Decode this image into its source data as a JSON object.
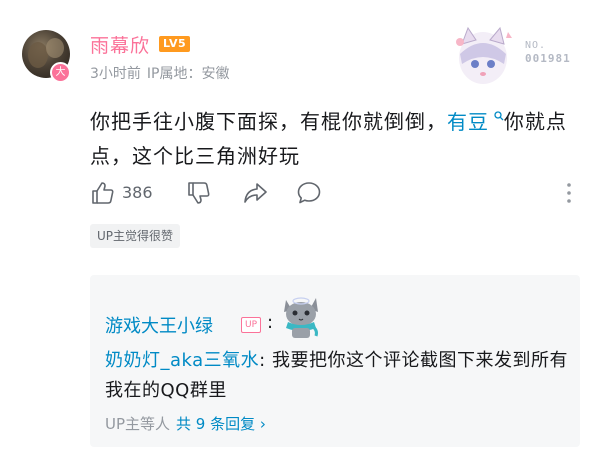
{
  "comment": {
    "username": "雨幕欣",
    "level": "LV5",
    "avatar_badge": "大",
    "time": "3小时前",
    "ip_location": "IP属地：安徽",
    "text_before_link": "你把手往小腹下面探，有棍你就倒倒，",
    "link_text": "有豆",
    "text_after_link": "你就点点，这个比三角洲好玩",
    "like_count": "386",
    "up_liked_label": "UP主觉得很赞",
    "decoration": {
      "no_label": "NO.",
      "number": "001981"
    }
  },
  "replies": {
    "first_reply": {
      "username": "游戏大王小绿",
      "up_tag": "UP",
      "colon": ":"
    },
    "second_reply": {
      "username": "奶奶灯_aka三氧水",
      "text": ": 我要把你这个评论截图下来发到所有我在的QQ群里"
    },
    "footer_prefix": "UP主等人",
    "footer_total": "共 9 条回复 ›"
  },
  "colors": {
    "brand_pink": "#fb7299",
    "link_blue": "#008ac5",
    "level_orange": "#ff9a1f",
    "secondary_text": "#9499a0"
  },
  "icons": [
    "thumb-up-icon",
    "thumb-down-icon",
    "share-icon",
    "reply-icon",
    "more-icon",
    "search-icon"
  ]
}
